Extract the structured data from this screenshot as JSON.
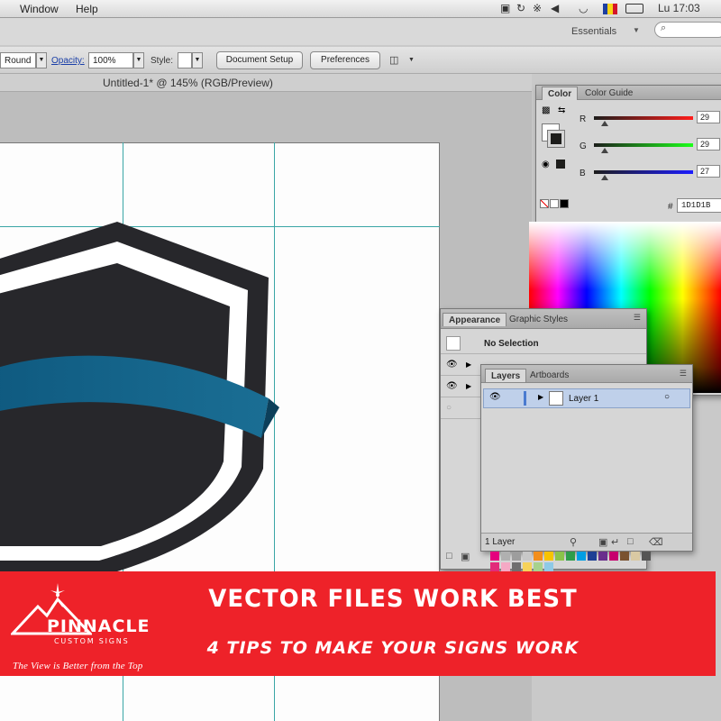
{
  "menubar": {
    "items": [
      "Window",
      "Help"
    ],
    "clock": "Lu 17:03"
  },
  "workspace": {
    "label": "Essentials",
    "search_glyph": "⌕"
  },
  "control_bar": {
    "stroke_profile": "Round",
    "opacity_label": "Opacity:",
    "opacity_value": "100%",
    "style_label": "Style:",
    "document_setup_label": "Document Setup",
    "preferences_label": "Preferences"
  },
  "document": {
    "title": "Untitled-1* @ 145% (RGB/Preview)"
  },
  "color_panel": {
    "tabs": [
      "Color",
      "Color Guide"
    ],
    "channels": [
      {
        "label": "R",
        "value": "29",
        "fraction": 0.11
      },
      {
        "label": "G",
        "value": "29",
        "fraction": 0.11
      },
      {
        "label": "B",
        "value": "27",
        "fraction": 0.11
      }
    ],
    "hex_prefix": "#",
    "hex": "1D1D1B"
  },
  "appearance_panel": {
    "tabs": [
      "Appearance",
      "Graphic Styles"
    ],
    "selection_text": "No Selection"
  },
  "layers_panel": {
    "tabs": [
      "Layers",
      "Artboards"
    ],
    "layer_name": "Layer 1",
    "footer_count": "1 Layer"
  },
  "banner": {
    "headline": "VECTOR FILES WORK BEST",
    "subheadline": "4 TIPS TO MAKE YOUR SIGNS WORK",
    "brand": "PINNACLE",
    "brand_sub": "CUSTOM SIGNS",
    "tagline": "The View is Better from the Top"
  },
  "colors": {
    "banner_red": "#ee2229",
    "shield_dark": "#27272b",
    "ribbon_blue": "#1a6e94",
    "guide_teal": "#3aa6a6"
  }
}
